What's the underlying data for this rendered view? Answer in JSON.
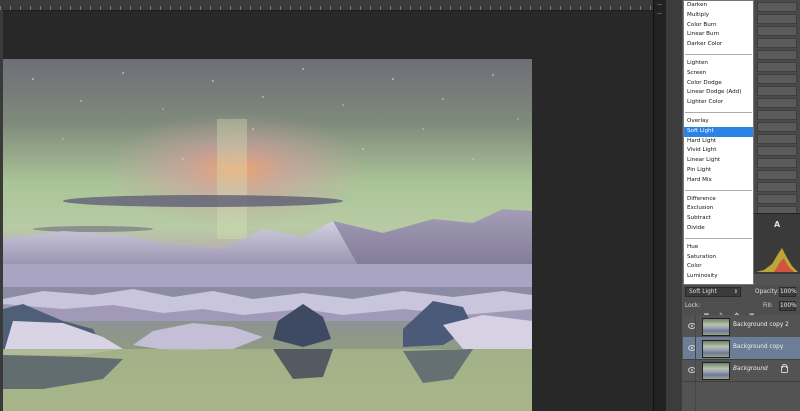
{
  "blend_modes": {
    "groups": [
      [
        "Darken",
        "Multiply",
        "Color Burn",
        "Linear Burn",
        "Darker Color"
      ],
      [
        "Lighten",
        "Screen",
        "Color Dodge",
        "Linear Dodge (Add)",
        "Lighter Color"
      ],
      [
        "Overlay",
        "Soft Light",
        "Hard Light",
        "Vivid Light",
        "Linear Light",
        "Pin Light",
        "Hard Mix"
      ],
      [
        "Difference",
        "Exclusion",
        "Subtract",
        "Divide"
      ],
      [
        "Hue",
        "Saturation",
        "Color",
        "Luminosity"
      ]
    ],
    "selected": "Soft Light"
  },
  "layers_panel": {
    "blend_mode_value": "Soft Light",
    "opacity_label": "Opacity:",
    "opacity_value": "100%",
    "lock_label": "Lock:",
    "fill_label": "Fill:",
    "fill_value": "100%",
    "layers": [
      {
        "name": "Background copy 2",
        "selected": false,
        "locked": false
      },
      {
        "name": "Background copy",
        "selected": true,
        "locked": false
      },
      {
        "name": "Background",
        "selected": false,
        "locked": true
      }
    ]
  },
  "histogram_label": "A",
  "colors": {
    "menu_highlight": "#2b83e6",
    "selected_layer": "#6c7d97",
    "panel_bg": "#535353",
    "workspace_bg": "#282828"
  }
}
